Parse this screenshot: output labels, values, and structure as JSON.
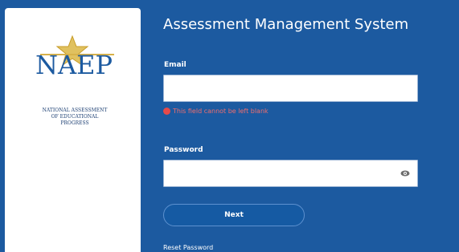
{
  "logo": {
    "brand": "NAEP",
    "caption_line1": "National Assessment",
    "caption_line2": "of Educational",
    "caption_line3": "Progress"
  },
  "header": {
    "title": "Assessment Management System"
  },
  "form": {
    "email_label": "Email",
    "email_value": "",
    "email_error": "This field cannot be left blank",
    "password_label": "Password",
    "password_value": "",
    "next_label": "Next",
    "reset_label": "Reset Password"
  },
  "icons": {
    "star": "star-icon",
    "error": "error-icon",
    "password_toggle": "eye-icon"
  },
  "colors": {
    "background": "#1c5aa0",
    "error": "#e54a4a",
    "logo_gold": "#d8b24a"
  }
}
